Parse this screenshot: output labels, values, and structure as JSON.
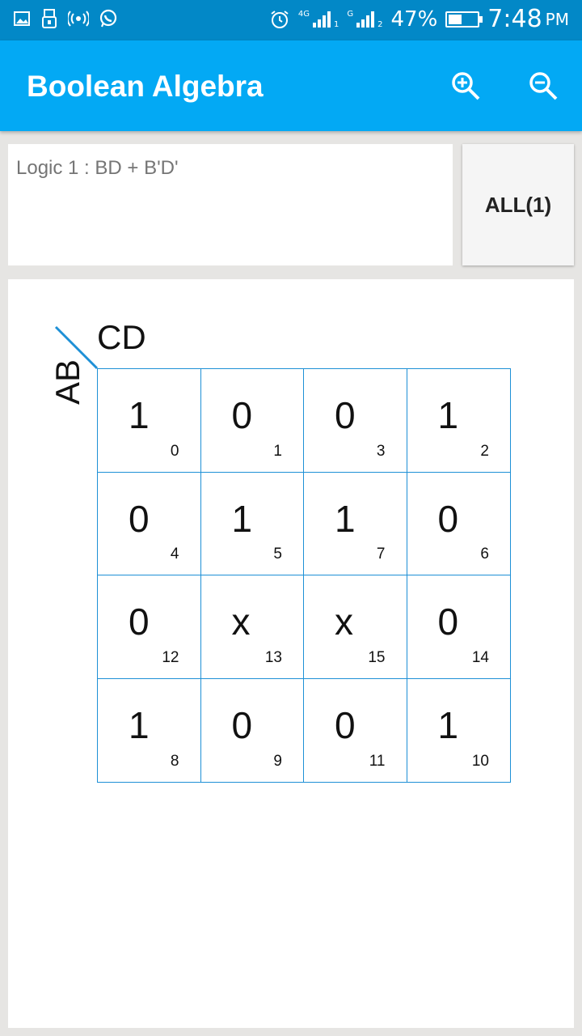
{
  "status_bar": {
    "battery_percent": "47%",
    "battery_level": 0.47,
    "time": "7:48",
    "ampm": "PM",
    "net1": "4G",
    "net2": "G",
    "sim1": "1",
    "sim2": "2"
  },
  "app_bar": {
    "title": "Boolean Algebra",
    "icons": [
      "zoom-in-icon",
      "zoom-out-icon"
    ]
  },
  "expression": {
    "text": "Logic 1 : BD + B'D'"
  },
  "all_button": {
    "label": "ALL(1)"
  },
  "kmap": {
    "col_var": "CD",
    "row_var": "AB",
    "rows": [
      [
        {
          "value": "1",
          "index": "0"
        },
        {
          "value": "0",
          "index": "1"
        },
        {
          "value": "0",
          "index": "3"
        },
        {
          "value": "1",
          "index": "2"
        }
      ],
      [
        {
          "value": "0",
          "index": "4"
        },
        {
          "value": "1",
          "index": "5"
        },
        {
          "value": "1",
          "index": "7"
        },
        {
          "value": "0",
          "index": "6"
        }
      ],
      [
        {
          "value": "0",
          "index": "12"
        },
        {
          "value": "x",
          "index": "13"
        },
        {
          "value": "x",
          "index": "15"
        },
        {
          "value": "0",
          "index": "14"
        }
      ],
      [
        {
          "value": "1",
          "index": "8"
        },
        {
          "value": "0",
          "index": "9"
        },
        {
          "value": "0",
          "index": "11"
        },
        {
          "value": "1",
          "index": "10"
        }
      ]
    ]
  },
  "colors": {
    "status_bar": "#0288c7",
    "app_bar": "#03a9f4",
    "grid_line": "#1e90d6"
  }
}
